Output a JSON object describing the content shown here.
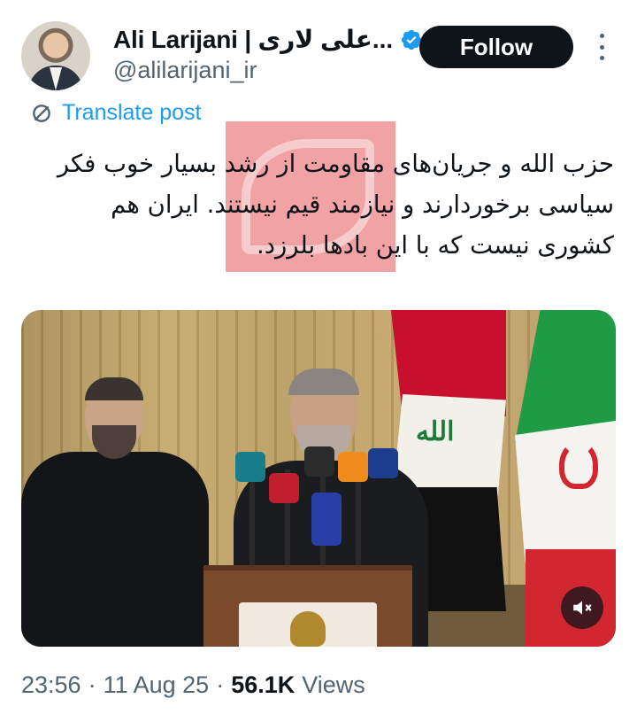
{
  "author": {
    "display_name": "Ali Larijani | علی لاری...",
    "handle": "@alilarijani_ir",
    "verified": true
  },
  "actions": {
    "follow_label": "Follow",
    "more_icon": "more-vertical-icon"
  },
  "translate": {
    "label": "Translate post",
    "icon": "translate-icon"
  },
  "post": {
    "text": "حزب الله و جریان‌های مقاومت از رشد بسیار خوب فکر سیاسی برخوردارند و نیازمند قیم نیستند. ایران هم کشوری نیست که با این بادها بلرزد."
  },
  "media": {
    "mute_icon": "speaker-muted-icon"
  },
  "meta": {
    "time": "23:56",
    "date": "11 Aug 25",
    "views_count": "56.1K",
    "views_label": "Views",
    "separator": "·"
  },
  "colors": {
    "accent": "#1d9bf0",
    "text": "#0f1419",
    "secondary": "#536471",
    "button_bg": "#0f1419"
  }
}
